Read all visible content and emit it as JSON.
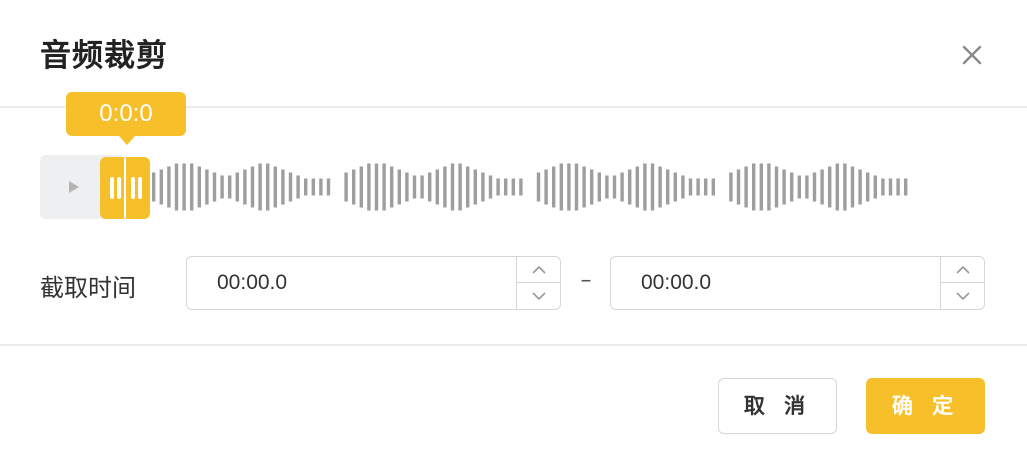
{
  "dialog": {
    "title": "音频裁剪",
    "close_icon": "close-icon"
  },
  "colors": {
    "accent": "#f7c02b",
    "wave_bar": "#9e9e9e",
    "play_area": "#eeeff1"
  },
  "waveform": {
    "play_icon": "play-icon",
    "playhead_time": "0:0:0",
    "segment_pattern": [
      29,
      35,
      41,
      47,
      47,
      47,
      41,
      35,
      29,
      23,
      23,
      29,
      35,
      41,
      47,
      47,
      41,
      35,
      29,
      23,
      17,
      17,
      17,
      17
    ],
    "segment_count": 4
  },
  "range": {
    "label": "截取时间",
    "separator": "–",
    "start": {
      "value": "00:00.0",
      "up_icon": "chevron-up-icon",
      "down_icon": "chevron-down-icon"
    },
    "end": {
      "value": "00:00.0",
      "up_icon": "chevron-up-icon",
      "down_icon": "chevron-down-icon"
    }
  },
  "footer": {
    "cancel_label": "取 消",
    "confirm_label": "确 定"
  }
}
